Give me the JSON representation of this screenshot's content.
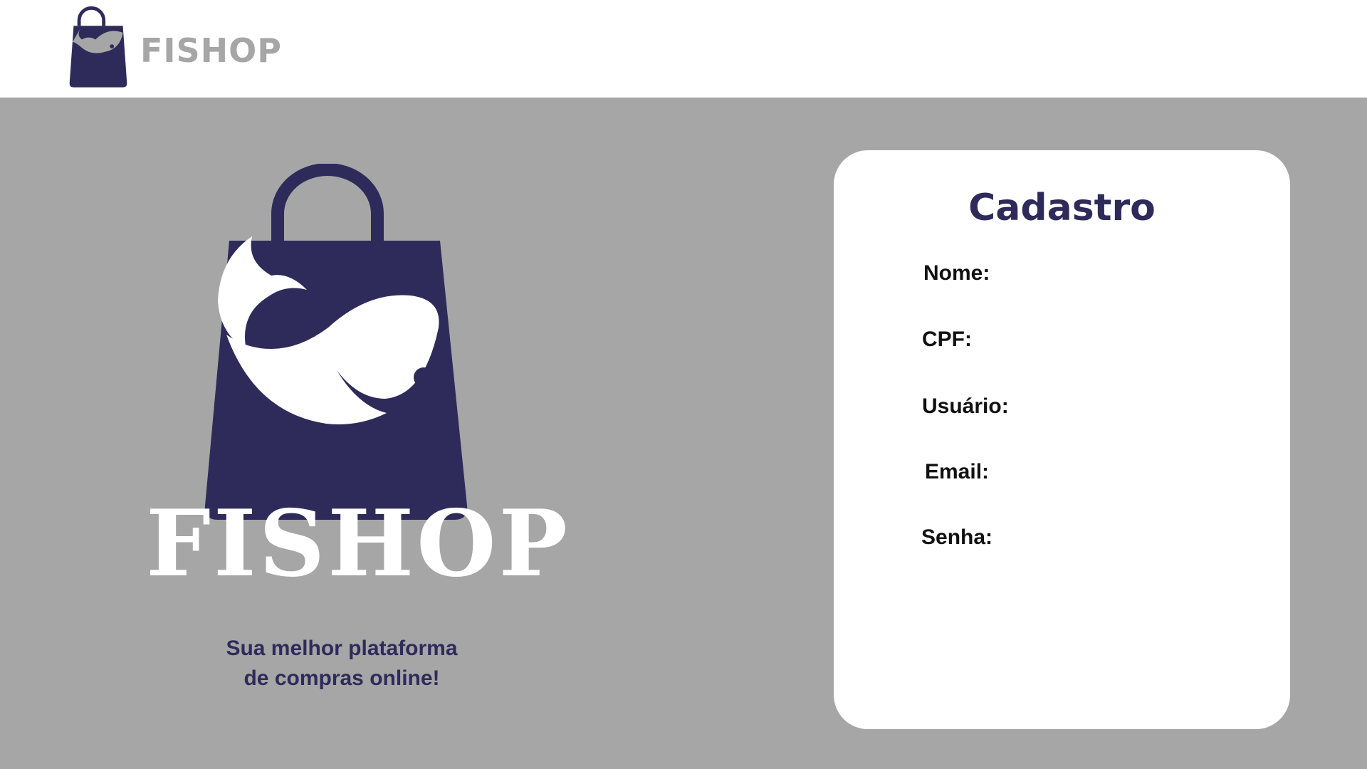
{
  "header": {
    "brand": "FISHOP"
  },
  "hero": {
    "brand": "FISHOP",
    "tagline_line1": "Sua melhor plataforma",
    "tagline_line2": "de compras online!"
  },
  "form": {
    "title": "Cadastro",
    "fields": [
      {
        "label": "Nome:"
      },
      {
        "label": "CPF:"
      },
      {
        "label": "Usuário:"
      },
      {
        "label": "Email:"
      },
      {
        "label": "Senha:"
      }
    ]
  },
  "colors": {
    "brand_navy": "#2e2b5b",
    "background_gray": "#a6a6a6",
    "white": "#ffffff"
  },
  "icons": {
    "header_logo": "fish-shopping-bag-icon",
    "hero_logo": "fish-shopping-bag-icon"
  }
}
